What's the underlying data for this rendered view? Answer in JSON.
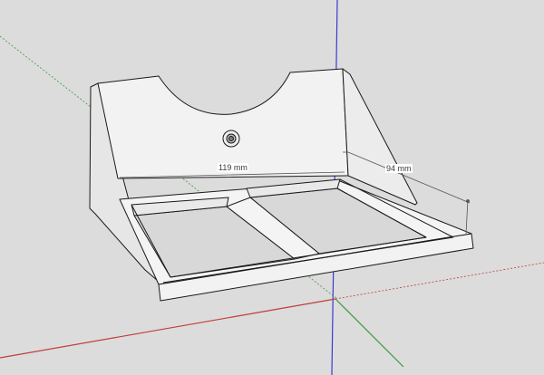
{
  "model": {
    "dimensions": {
      "width": "119 mm",
      "depth": "94 mm"
    }
  },
  "colors": {
    "background": "#dcdcdc",
    "face": "#f2f2f2",
    "face_shade": "#e6e6e6",
    "slot_floor": "#d4d4d4",
    "edge": "#1a1a1a",
    "axis_red": "#c23b3b",
    "axis_green": "#3b9a3b",
    "axis_blue": "#3b3bd0"
  }
}
